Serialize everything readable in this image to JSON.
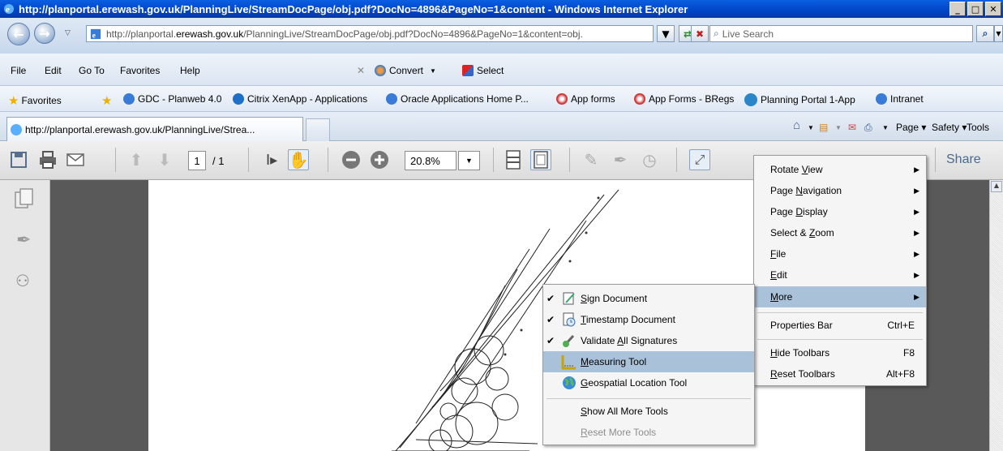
{
  "window": {
    "title": "http://planportal.erewash.gov.uk/PlanningLive/StreamDocPage/obj.pdf?DocNo=4896&PageNo=1&content - Windows Internet Explorer"
  },
  "address": {
    "url_prefix": "http://planportal.",
    "url_domain": "erewash.gov.uk",
    "url_rest": "/PlanningLive/StreamDocPage/obj.pdf?DocNo=4896&PageNo=1&content=obj.",
    "search_placeholder": "Live Search"
  },
  "menu": {
    "items": [
      "File",
      "Edit",
      "Go To",
      "Favorites",
      "Help"
    ],
    "convert": "Convert",
    "select": "Select"
  },
  "favorites": {
    "label": "Favorites",
    "items": [
      "GDC - Planweb 4.0",
      "Citrix XenApp - Applications",
      "Oracle Applications Home P...",
      "App forms",
      "App Forms - BRegs",
      "Planning Portal 1-App",
      "Intranet"
    ]
  },
  "tabs": {
    "active_tab": "http://planportal.erewash.gov.uk/PlanningLive/Strea..."
  },
  "commandbar": {
    "page": "Page",
    "safety": "Safety",
    "tools": "Tools"
  },
  "pdf_toolbar": {
    "page_current": "1",
    "page_total": "/ 1",
    "zoom": "20.8%",
    "share": "Share"
  },
  "main_menu": {
    "items": [
      {
        "label_pre": "Rotate ",
        "label_u": "V",
        "label_post": "iew",
        "submenu": true
      },
      {
        "label_pre": "Page ",
        "label_u": "N",
        "label_post": "avigation",
        "submenu": true
      },
      {
        "label_pre": "Page ",
        "label_u": "D",
        "label_post": "isplay",
        "submenu": true
      },
      {
        "label_pre": "Select & ",
        "label_u": "Z",
        "label_post": "oom",
        "submenu": true
      },
      {
        "label_pre": "",
        "label_u": "F",
        "label_post": "ile",
        "submenu": true
      },
      {
        "label_pre": "",
        "label_u": "E",
        "label_post": "dit",
        "submenu": true
      },
      {
        "label_pre": "",
        "label_u": "M",
        "label_post": "ore",
        "submenu": true,
        "selected": true
      }
    ],
    "properties_bar": {
      "label": "Properties Bar",
      "shortcut": "Ctrl+E"
    },
    "hide_toolbars": {
      "label_u": "H",
      "label_post": "ide Toolbars",
      "shortcut": "F8"
    },
    "reset_toolbars": {
      "label_u": "R",
      "label_post": "eset Toolbars",
      "shortcut": "Alt+F8"
    }
  },
  "more_menu": {
    "sign": {
      "label_u": "S",
      "label_post": "ign Document"
    },
    "timestamp": {
      "label_u": "T",
      "label_post": "imestamp Document"
    },
    "validate": {
      "label_pre": "Validate ",
      "label_u": "A",
      "label_post": "ll Signatures"
    },
    "measuring": {
      "label_u": "M",
      "label_post": "easuring Tool"
    },
    "geospatial": {
      "label_u": "G",
      "label_post": "eospatial Location Tool"
    },
    "show_all": {
      "label_u": "S",
      "label_post": "how All More Tools"
    },
    "reset": {
      "label_u": "R",
      "label_post": "eset More Tools"
    }
  }
}
